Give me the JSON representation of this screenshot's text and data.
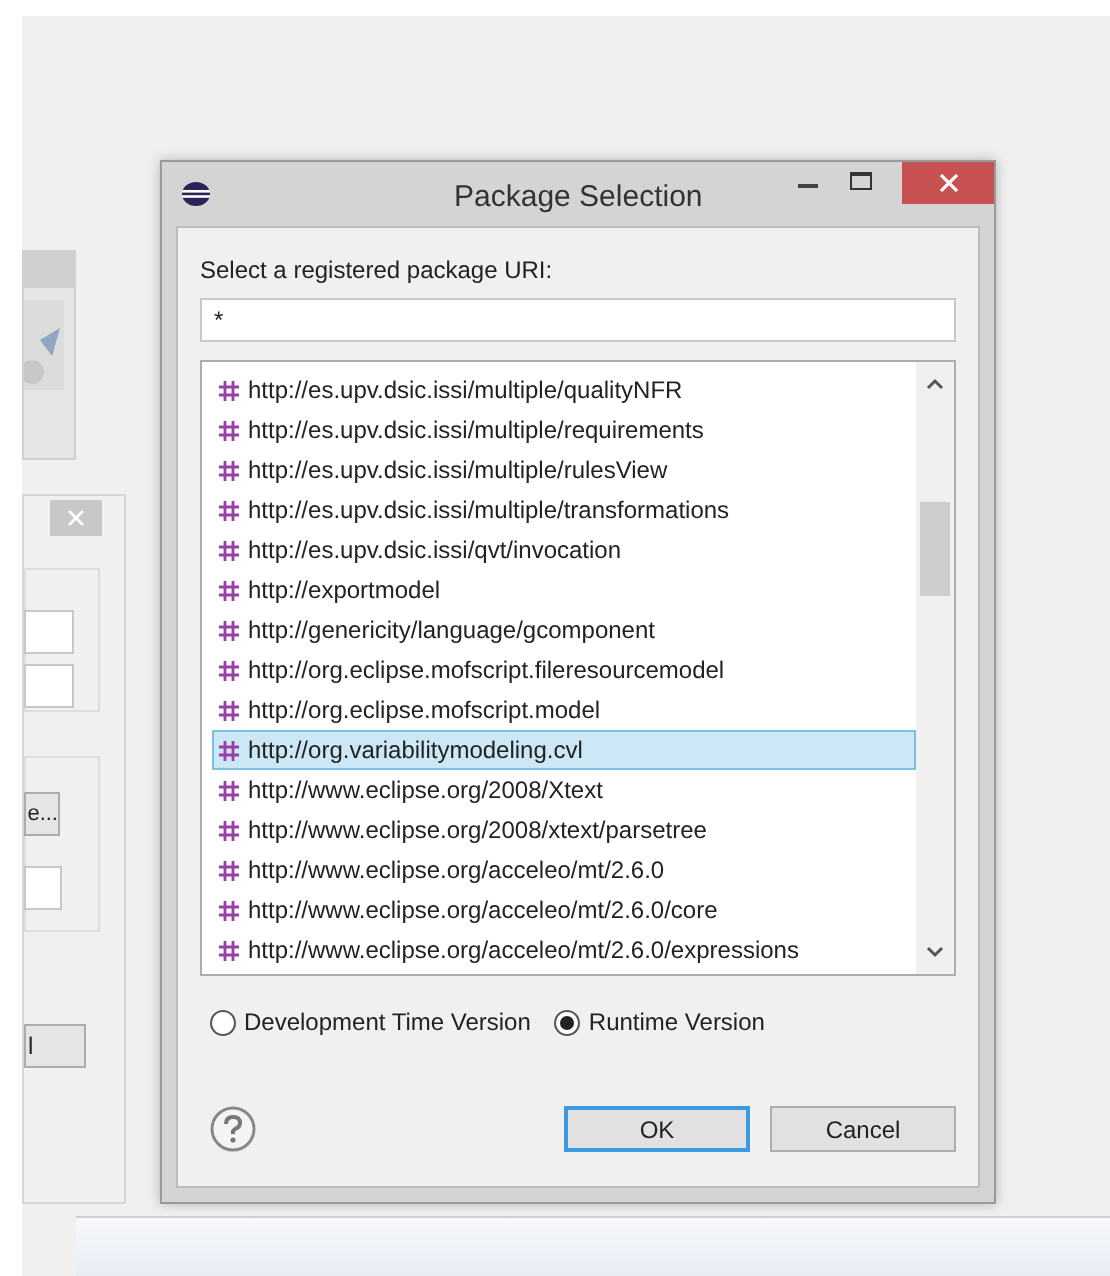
{
  "background_window": {
    "button_label": "e...",
    "button_2_label": "l"
  },
  "dialog": {
    "title": "Package Selection",
    "prompt": "Select a registered package URI:",
    "filter": {
      "value": "*"
    },
    "packages": [
      {
        "uri": "http://es.upv.dsic.issi/multiple/qualityNFR",
        "selected": false
      },
      {
        "uri": "http://es.upv.dsic.issi/multiple/requirements",
        "selected": false
      },
      {
        "uri": "http://es.upv.dsic.issi/multiple/rulesView",
        "selected": false
      },
      {
        "uri": "http://es.upv.dsic.issi/multiple/transformations",
        "selected": false
      },
      {
        "uri": "http://es.upv.dsic.issi/qvt/invocation",
        "selected": false
      },
      {
        "uri": "http://exportmodel",
        "selected": false
      },
      {
        "uri": "http://genericity/language/gcomponent",
        "selected": false
      },
      {
        "uri": "http://org.eclipse.mofscript.fileresourcemodel",
        "selected": false
      },
      {
        "uri": "http://org.eclipse.mofscript.model",
        "selected": false
      },
      {
        "uri": "http://org.variabilitymodeling.cvl",
        "selected": true
      },
      {
        "uri": "http://www.eclipse.org/2008/Xtext",
        "selected": false
      },
      {
        "uri": "http://www.eclipse.org/2008/xtext/parsetree",
        "selected": false
      },
      {
        "uri": "http://www.eclipse.org/acceleo/mt/2.6.0",
        "selected": false
      },
      {
        "uri": "http://www.eclipse.org/acceleo/mt/2.6.0/core",
        "selected": false
      },
      {
        "uri": "http://www.eclipse.org/acceleo/mt/2.6.0/expressions",
        "selected": false
      }
    ],
    "versions": [
      {
        "label": "Development Time Version",
        "selected": false
      },
      {
        "label": "Runtime Version",
        "selected": true
      }
    ],
    "buttons": [
      {
        "label": "OK",
        "default": true
      },
      {
        "label": "Cancel",
        "default": false
      }
    ]
  }
}
